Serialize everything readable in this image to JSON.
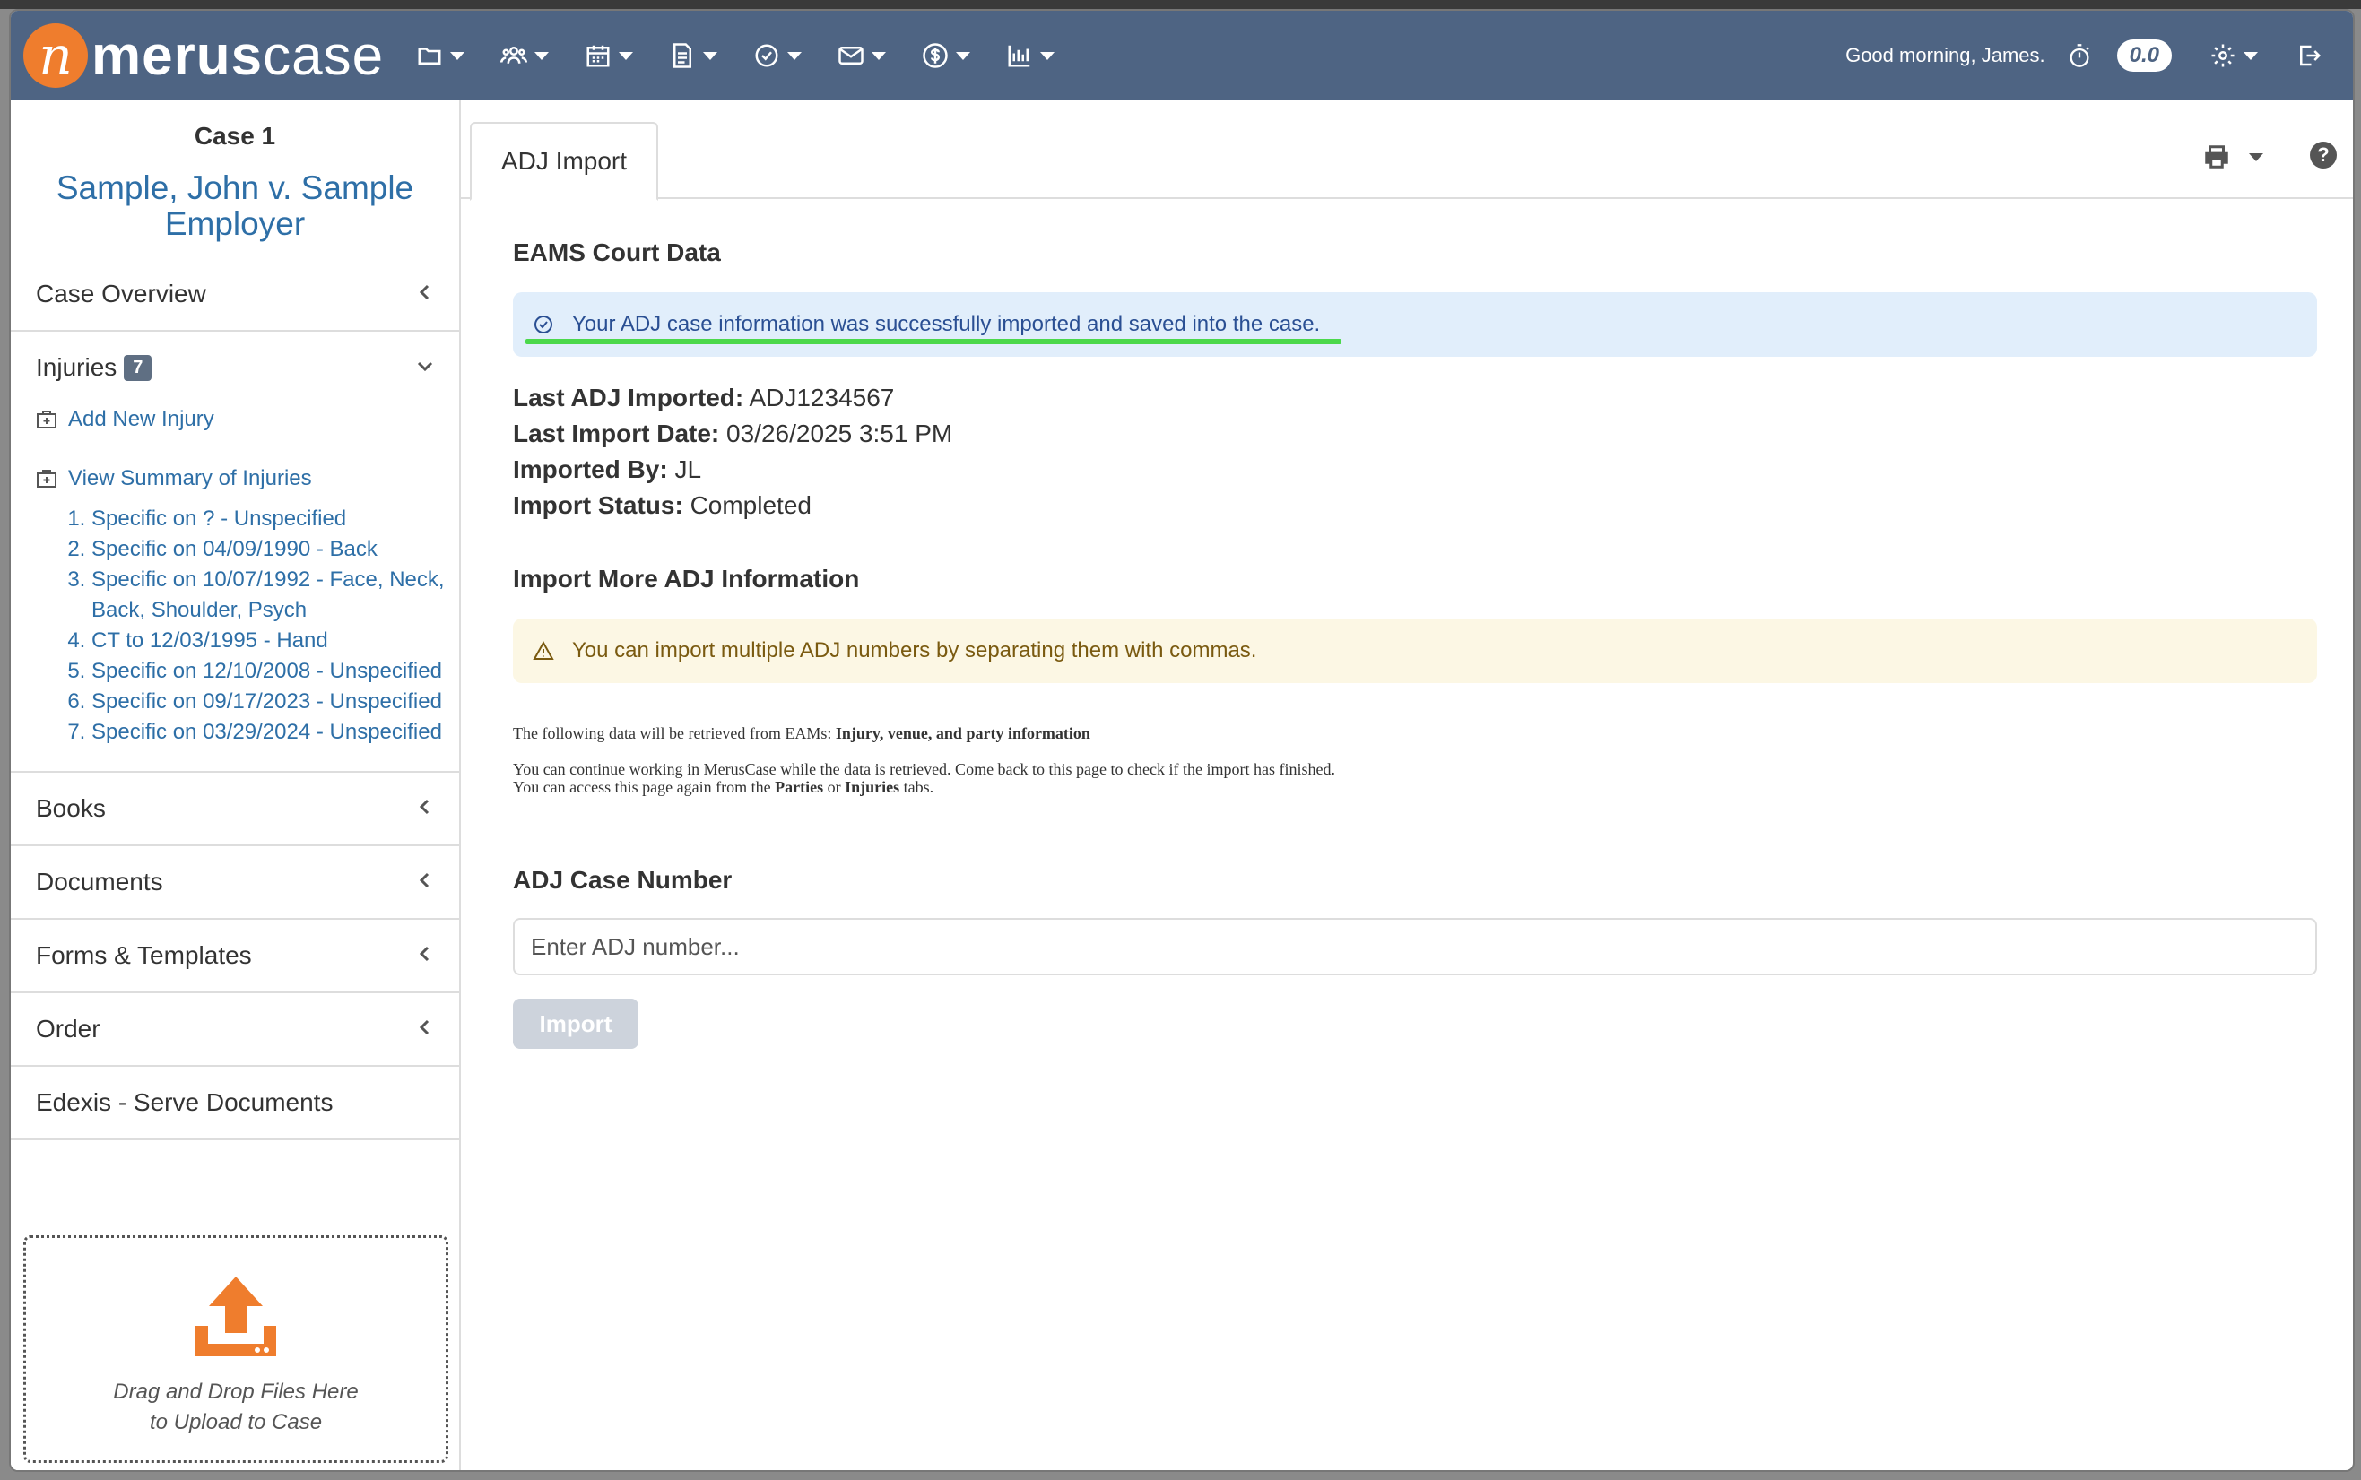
{
  "navbar": {
    "logo_letter": "n",
    "logo_bold": "merus",
    "logo_light": "case",
    "icons": [
      "folder-icon",
      "users-icon",
      "calendar-icon",
      "document-icon",
      "check-circle-icon",
      "envelope-icon",
      "dollar-icon",
      "bar-chart-icon"
    ],
    "greeting": "Good morning, James.",
    "timer_value": "0.0"
  },
  "sidebar": {
    "case_number": "Case 1",
    "case_title": "Sample, John v. Sample Employer",
    "sections": {
      "case_overview": "Case Overview",
      "injuries": "Injuries",
      "injuries_count": "7",
      "books": "Books",
      "documents": "Documents",
      "forms_templates": "Forms & Templates",
      "order": "Order",
      "edexis": "Edexis - Serve Documents"
    },
    "add_new_injury": "Add New Injury",
    "view_summary": "View Summary of Injuries",
    "injuries": [
      "Specific on ? - Unspecified",
      "Specific on 04/09/1990 - Back",
      "Specific on 10/07/1992 - Face, Neck, Back, Shoulder, Psych",
      "CT to 12/03/1995 - Hand",
      "Specific on 12/10/2008 - Unspecified",
      "Specific on 09/17/2023 - Unspecified",
      "Specific on 03/29/2024 - Unspecified"
    ],
    "dropzone_line1": "Drag and Drop Files Here",
    "dropzone_line2": "to Upload to Case"
  },
  "main": {
    "tab_label": "ADJ Import",
    "eams_heading": "EAMS Court Data",
    "success_message": "Your ADJ case information was successfully imported and saved into the case.",
    "last_adj_label": "Last ADJ Imported:",
    "last_adj_value": "ADJ1234567",
    "last_date_label": "Last Import Date:",
    "last_date_value": "03/26/2025 3:51 PM",
    "imported_by_label": "Imported By:",
    "imported_by_value": "JL",
    "status_label": "Import Status:",
    "status_value": "Completed",
    "import_more_heading": "Import More ADJ Information",
    "warning_message": "You can import multiple ADJ numbers by separating them with commas.",
    "note_retrieved_prefix": "The following data will be retrieved from EAMs:",
    "note_retrieved_bold": "Injury, venue, and party information",
    "note_continue": "You can continue working in MerusCase while the data is retrieved. Come back to this page to check if the import has finished.",
    "note_access_prefix": "You can access this page again from the",
    "note_parties": "Parties",
    "note_or": "or",
    "note_injuries": "Injuries",
    "note_tabs": "tabs.",
    "case_number_heading": "ADJ Case Number",
    "input_placeholder": "Enter ADJ number...",
    "import_button": "Import"
  },
  "colors": {
    "navbar": "#4e6483",
    "accent_orange": "#ef7d2d",
    "link_blue": "#2e6fa7",
    "success_bg": "#e1eefb",
    "warning_bg": "#fcf7e4",
    "highlight_underline": "#4bd84b"
  }
}
